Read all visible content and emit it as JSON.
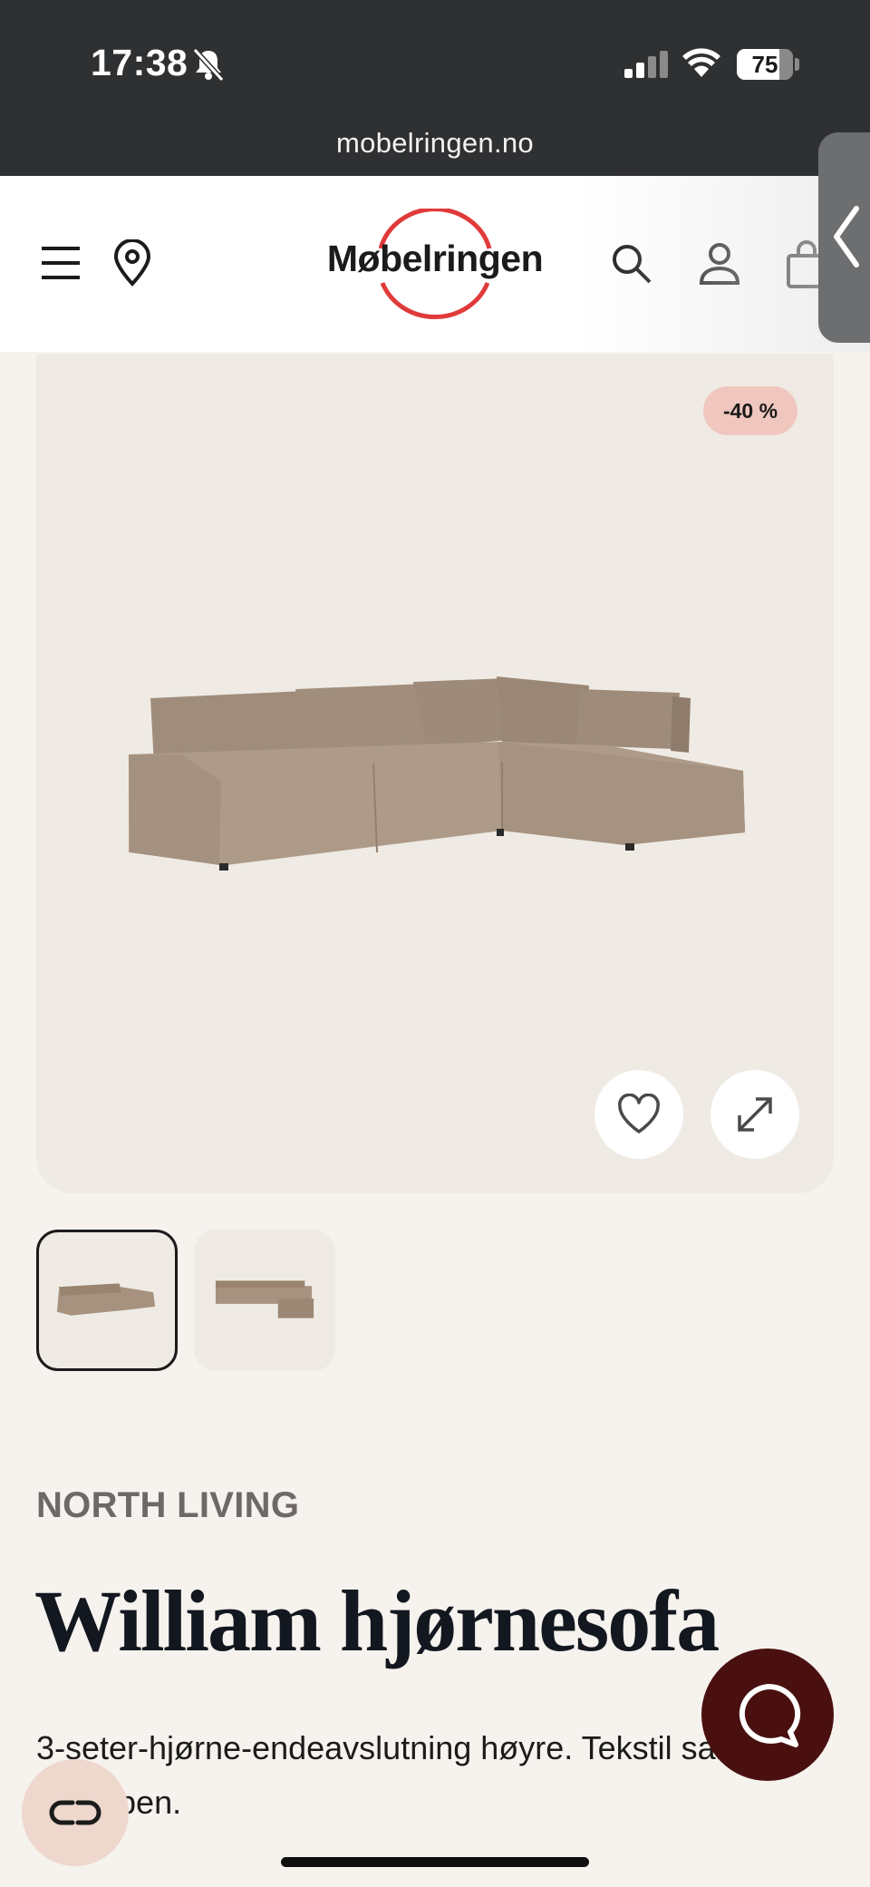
{
  "status_bar": {
    "time": "17:38",
    "battery_percent": "75",
    "battery_level": 0.75,
    "icons": [
      "bell-slash-icon",
      "cellular-signal-icon",
      "wifi-icon",
      "battery-icon"
    ]
  },
  "browser": {
    "url": "mobelringen.no"
  },
  "header": {
    "logo_text": "Møbelringen",
    "brand_color": "#e03a3a",
    "icons": [
      "menu-icon",
      "location-pin-icon",
      "search-icon",
      "account-icon",
      "shopping-bag-icon"
    ]
  },
  "product": {
    "discount_badge": "-40 %",
    "brand": "NORTH LIVING",
    "title": "William hjørnesofa",
    "description": "3-seter-hjørne-endeavslutning høyre. Tekstil sand, sorte ben.",
    "selected_thumbnail": 1,
    "thumbnail_count": 2
  },
  "actions": {
    "favorite_icon": "heart-icon",
    "expand_icon": "expand-arrows-icon",
    "chat_icon": "chat-bubble-icon",
    "cobrowse_icon": "cobrowse-link-icon"
  },
  "colors": {
    "chat_button": "#4a1010",
    "badge": "#f0c7bf",
    "background": "#f6f2ee"
  }
}
